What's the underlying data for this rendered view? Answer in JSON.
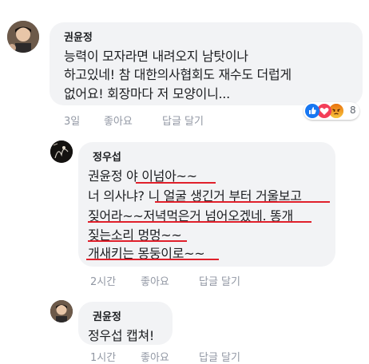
{
  "comments": [
    {
      "author": "권윤정",
      "lines": [
        "능력이 모자라면  내려오지 남탓이나",
        "하고있네! 참 대한의사협회도  재수도 더럽게",
        "없어요!  회장마다 저 모양이니..."
      ],
      "time": "3일",
      "like": "좋아요",
      "reply": "답글 달기",
      "reaction_count": "8",
      "reactions": [
        "like-reaction",
        "love-reaction",
        "angry-reaction"
      ]
    },
    {
      "author": "정우섭",
      "line1_prefix": "권윤정 ",
      "line1_rest": "야 이넘아~~",
      "line2": "너 의사냐? 니 얼굴 생긴거 부터 거울보고",
      "line3": "짖어라~~저녁먹은거 넘어오겠네. 똥개",
      "line4": "짖는소리 멍멍~~",
      "line5": "개새키는 몽둥이로~~",
      "time": "2시간",
      "like": "좋아요",
      "reply": "답글 달기",
      "highlight_color": "#e0202b"
    },
    {
      "author": "권윤정",
      "text": "정우섭 캡쳐!",
      "time": "1시간",
      "like": "좋아요",
      "reply": "답글 달기"
    }
  ]
}
